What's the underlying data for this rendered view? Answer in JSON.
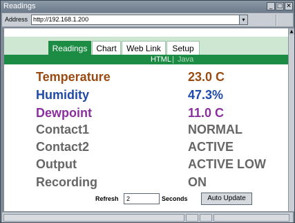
{
  "window": {
    "title": "Readings",
    "buttons": {
      "minimize": "_",
      "maximize": "□",
      "close": "✕"
    }
  },
  "address": {
    "label": "Address",
    "url": "http://192.168.1.200",
    "dropdown": "▾"
  },
  "tabs": [
    {
      "label": "Readings",
      "active": true
    },
    {
      "label": "Chart",
      "active": false
    },
    {
      "label": "Web Link",
      "active": false
    },
    {
      "label": "Setup",
      "active": false
    }
  ],
  "subnav": {
    "html": "HTML",
    "separator": "|",
    "java": "Java"
  },
  "readings": [
    {
      "label": "Temperature",
      "value": "23.0 C",
      "color": "#9a4a12"
    },
    {
      "label": "Humidity",
      "value": "47.3%",
      "color": "#1f4aa8"
    },
    {
      "label": "Dewpoint",
      "value": "11.0 C",
      "color": "#8a2f9e"
    },
    {
      "label": "Contact1",
      "value": "NORMAL",
      "color": "#666666"
    },
    {
      "label": "Contact2",
      "value": "ACTIVE",
      "color": "#666666"
    },
    {
      "label": "Output",
      "value": "ACTIVE LOW",
      "color": "#666666"
    },
    {
      "label": "Recording",
      "value": "ON",
      "color": "#666666"
    }
  ],
  "refresh": {
    "label": "Refresh",
    "value": "2",
    "units": "Seconds",
    "button": "Auto Update"
  },
  "colors": {
    "accent": "#1c8b43",
    "tab_band": "#cde7d3"
  }
}
